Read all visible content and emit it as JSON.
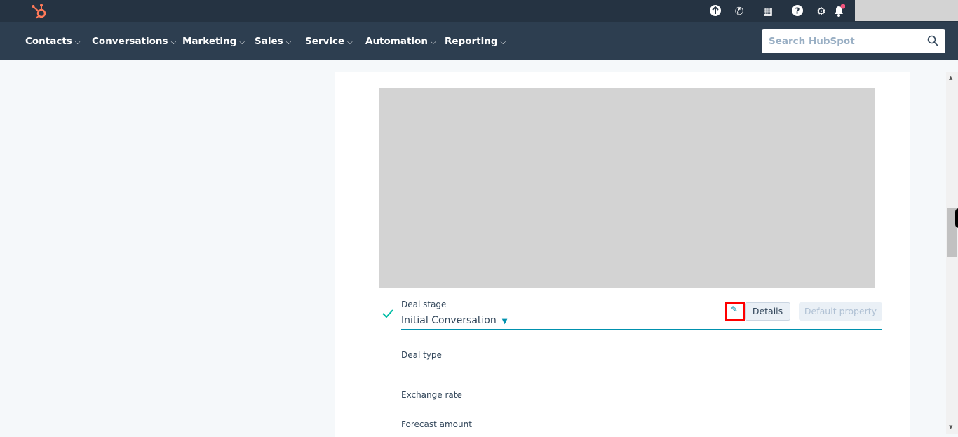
{
  "topbar": {
    "icons": [
      "upgrade-icon",
      "calling-icon",
      "marketplace-icon",
      "help-icon",
      "settings-icon",
      "notifications-icon"
    ],
    "notification_dot_color": "#f2547d"
  },
  "nav": {
    "items": [
      {
        "label": "Contacts"
      },
      {
        "label": "Conversations"
      },
      {
        "label": "Marketing"
      },
      {
        "label": "Sales"
      },
      {
        "label": "Service"
      },
      {
        "label": "Automation"
      },
      {
        "label": "Reporting"
      }
    ],
    "chevron": "⌵",
    "search_placeholder": "Search HubSpot"
  },
  "properties": [
    {
      "label": "Deal stage",
      "value": "Initial Conversation"
    },
    {
      "label": "Deal type"
    },
    {
      "label": "Exchange rate"
    },
    {
      "label": "Forecast amount"
    }
  ],
  "actions": {
    "details": "Details",
    "default_property": "Default property"
  },
  "colors": {
    "accent": "#0091ae",
    "check": "#00bda5",
    "highlight": "#ff0000"
  }
}
